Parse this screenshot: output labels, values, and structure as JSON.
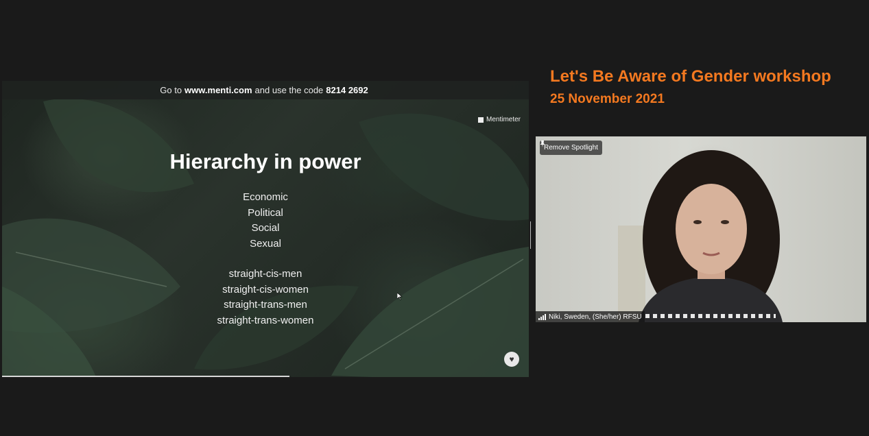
{
  "slide": {
    "instruction": {
      "prefix": "Go to",
      "site": "www.menti.com",
      "middle": "and use the code",
      "code": "8214 2692"
    },
    "brand": "Mentimeter",
    "title": "Hierarchy in power",
    "list1": [
      "Economic",
      "Political",
      "Social",
      "Sexual"
    ],
    "list2": [
      "straight-cis-men",
      "straight-cis-women",
      "straight-trans-men",
      "straight-trans-women"
    ],
    "reaction_icon": "heart-icon",
    "progress_fraction": 0.545
  },
  "event": {
    "title": "Let's Be Aware of Gender workshop",
    "date": "25 November 2021"
  },
  "participant": {
    "spotlight_button": "Remove Spotlight",
    "name": "Niki, Sweden, (She/her) RFSU",
    "signal_icon": "signal-bars-icon",
    "pin_icon": "pin-icon"
  },
  "colors": {
    "accent": "#f47920",
    "background": "#1a1a1a"
  }
}
